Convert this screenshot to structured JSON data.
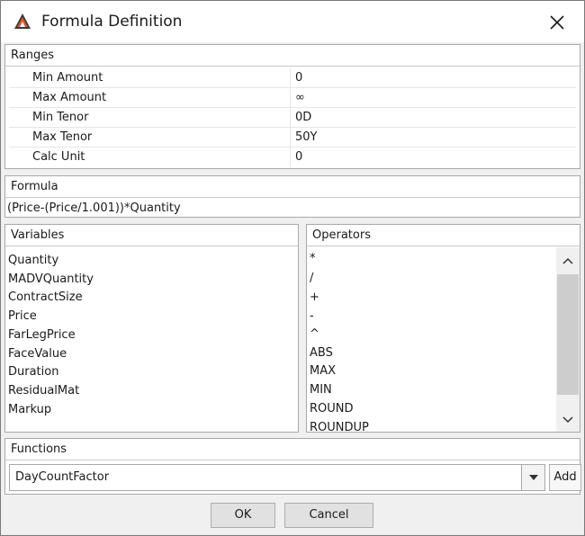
{
  "window": {
    "title": "Formula Definition",
    "icons": {
      "app": "app-logo-icon",
      "close": "close-icon"
    }
  },
  "ranges": {
    "header": "Ranges",
    "rows": [
      {
        "label": "Min Amount",
        "value": "0"
      },
      {
        "label": "Max Amount",
        "value": "∞"
      },
      {
        "label": "Min Tenor",
        "value": "0D"
      },
      {
        "label": "Max Tenor",
        "value": "50Y"
      },
      {
        "label": "Calc Unit",
        "value": "0"
      }
    ]
  },
  "formula": {
    "header": "Formula",
    "value": "(Price-(Price/1.001))*Quantity"
  },
  "variables": {
    "header": "Variables",
    "items": [
      "Quantity",
      "MADVQuantity",
      "ContractSize",
      "Price",
      "FarLegPrice",
      "FaceValue",
      "Duration",
      "ResidualMat",
      "Markup"
    ]
  },
  "operators": {
    "header": "Operators",
    "items": [
      "*",
      "/",
      "+",
      "-",
      "^",
      "ABS",
      "MAX",
      "MIN",
      "ROUND",
      "ROUNDUP"
    ]
  },
  "functions": {
    "header": "Functions",
    "selected": "DayCountFactor",
    "add_label": "Add"
  },
  "buttons": {
    "ok_label": "OK",
    "cancel_label": "Cancel"
  },
  "colors": {
    "logo_orange": "#e8501f",
    "logo_dark": "#3a3a3a"
  }
}
